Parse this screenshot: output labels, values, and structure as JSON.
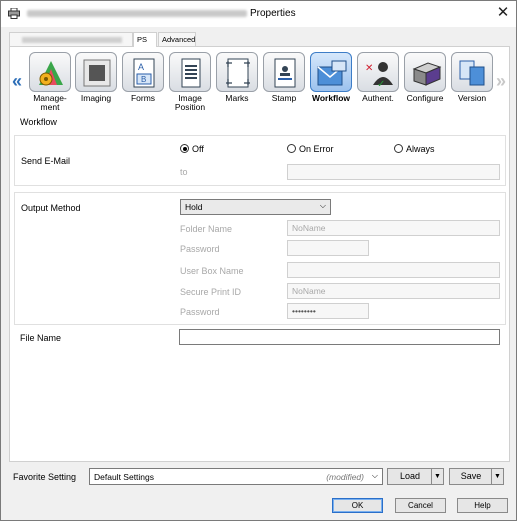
{
  "window": {
    "title": "Properties"
  },
  "tabs": [
    {
      "label": "PS"
    },
    {
      "label": "Advanced"
    }
  ],
  "toolbar": {
    "items": [
      {
        "label": "Manage-\nment",
        "icon": "management-icon"
      },
      {
        "label": "Imaging",
        "icon": "imaging-icon"
      },
      {
        "label": "Forms",
        "icon": "forms-icon"
      },
      {
        "label": "Image\nPosition",
        "icon": "image-position-icon"
      },
      {
        "label": "Marks",
        "icon": "marks-icon"
      },
      {
        "label": "Stamp",
        "icon": "stamp-icon"
      },
      {
        "label": "Workflow",
        "icon": "workflow-icon"
      },
      {
        "label": "Authent.",
        "icon": "authentication-icon"
      },
      {
        "label": "Configure",
        "icon": "configure-icon"
      },
      {
        "label": "Version",
        "icon": "version-icon"
      }
    ],
    "active": "Workflow"
  },
  "section": {
    "title": "Workflow"
  },
  "send_email": {
    "label": "Send E-Mail",
    "options": [
      "Off",
      "On Error",
      "Always"
    ],
    "selected": "Off",
    "to_label": "to",
    "to_value": ""
  },
  "output_method": {
    "label": "Output Method",
    "value": "Hold",
    "folder_name_label": "Folder Name",
    "folder_name_value": "NoName",
    "password_label": "Password",
    "password_value": "",
    "user_box_name_label": "User Box Name",
    "user_box_name_value": "",
    "secure_print_id_label": "Secure Print ID",
    "secure_print_id_value": "NoName",
    "password2_label": "Password",
    "password2_value": "••••••••"
  },
  "file_name": {
    "label": "File Name",
    "value": ""
  },
  "favorite": {
    "label": "Favorite Setting",
    "value": "Default Settings",
    "modified": "(modified)",
    "load_label": "Load",
    "save_label": "Save"
  },
  "buttons": {
    "ok": "OK",
    "cancel": "Cancel",
    "help": "Help"
  },
  "colors": {
    "accent": "#2e6fb8",
    "active_tool": "#9cc2ee"
  }
}
